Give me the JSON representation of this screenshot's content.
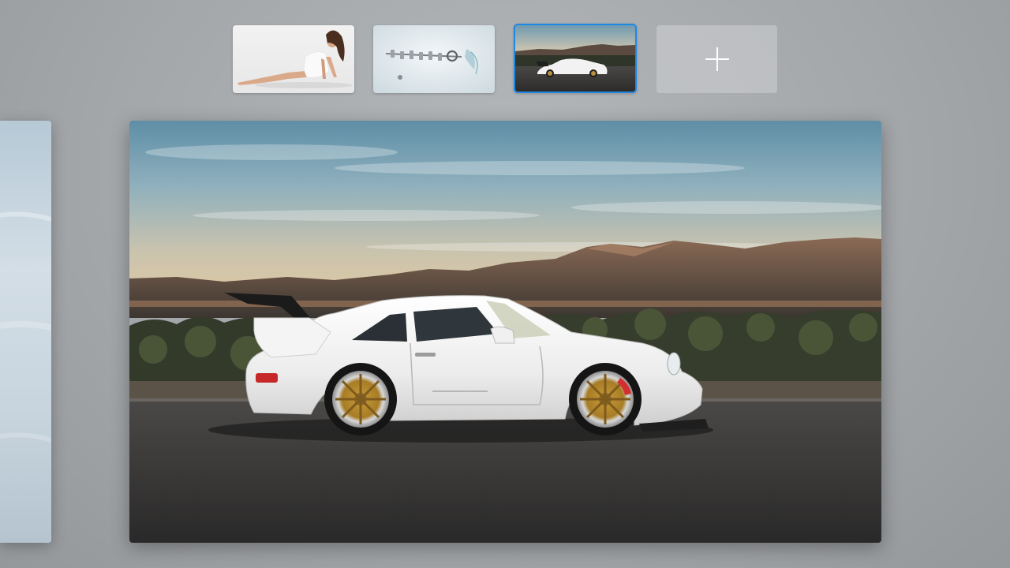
{
  "switcher": {
    "thumbnails": [
      {
        "name": "thumb-woman-photo",
        "active": false
      },
      {
        "name": "thumb-crankshaft-splash",
        "active": false
      },
      {
        "name": "thumb-white-porsche",
        "active": true
      }
    ],
    "add_button_icon": "plus-icon",
    "accent_color": "#1e88e5"
  },
  "windows": {
    "previous": {
      "icon": "sky-photo"
    },
    "current": {
      "icon": "white-porsche-desert-photo"
    }
  }
}
